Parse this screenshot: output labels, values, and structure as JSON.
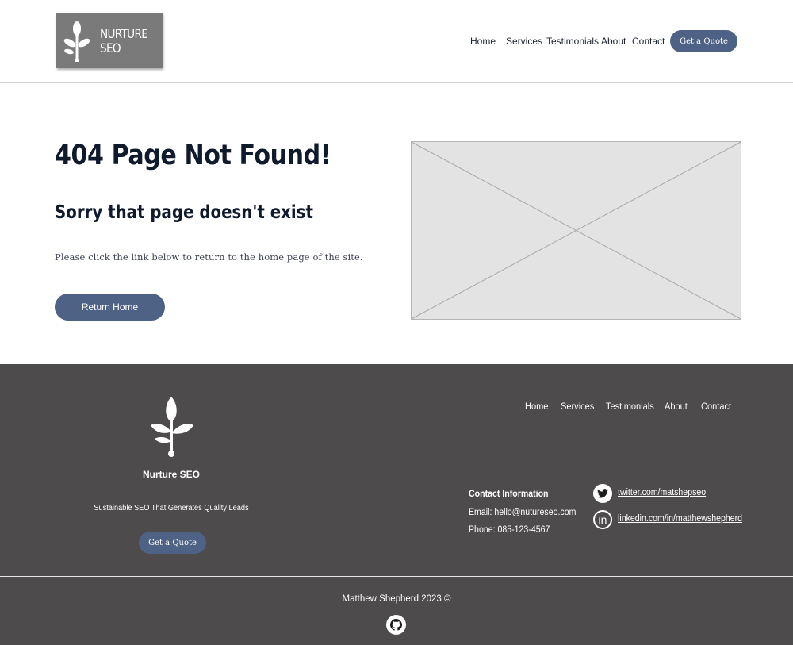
{
  "header": {
    "logo": {
      "line1": "NURTURE",
      "line2": "SEO",
      "icon": "sprout-icon"
    },
    "nav": [
      "Home",
      "Services",
      "Testimonials",
      "About",
      "Contact"
    ],
    "quote_button": "Get a Quote"
  },
  "main": {
    "title": "404 Page Not Found!",
    "subtitle": "Sorry that page doesn't exist",
    "text": "Please click the link below to return to the home page of the site.",
    "home_button": "Return Home",
    "image_icon": "image-placeholder-icon"
  },
  "footer": {
    "brand": "Nurture SEO",
    "tagline": "Sustainable SEO That Generates Quality Leads",
    "quote_button": "Get a Quote",
    "nav": [
      "Home",
      "Services",
      "Testimonials",
      "About",
      "Contact"
    ],
    "contact": {
      "title": "Contact Information",
      "email": "Email: hello@nutureseo.com",
      "phone": "Phone: 085-123-4567"
    },
    "social": [
      {
        "icon": "twitter-icon",
        "label": "twitter.com/matshepseo"
      },
      {
        "icon": "linkedin-icon",
        "label": "linkedin.com/in/matthewshepherd"
      }
    ],
    "copyright": "Matthew Shepherd 2023 ©",
    "github_icon": "github-icon"
  },
  "colors": {
    "accent": "#4e6285",
    "heading": "#0f1b2d",
    "footer_bg": "#4d4b4c",
    "logo_bg": "#7a7a7a",
    "placeholder_bg": "#e3e3e3"
  }
}
